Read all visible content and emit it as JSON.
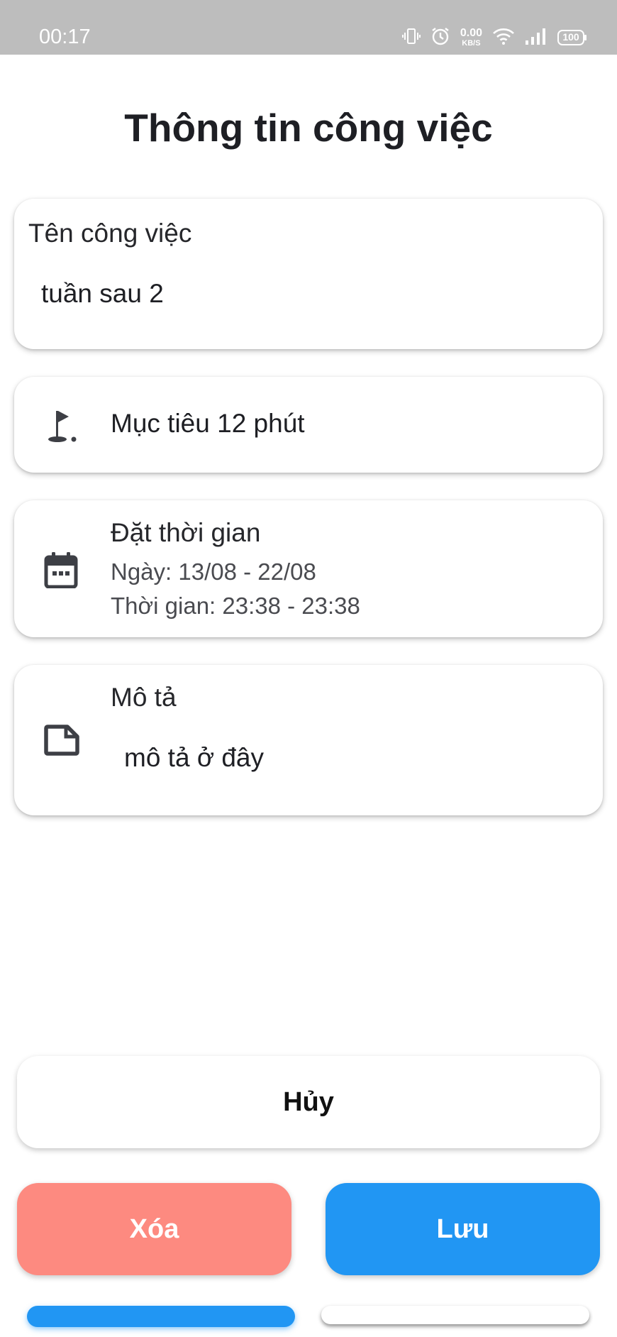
{
  "status_bar": {
    "time": "00:17",
    "speed_value": "0.00",
    "speed_unit": "KB/S",
    "battery": "100"
  },
  "page": {
    "title": "Thông tin công việc"
  },
  "task_name": {
    "label": "Tên công việc",
    "value": "tuần sau 2"
  },
  "goal": {
    "icon": "golf-flag-icon",
    "text": "Mục tiêu 12 phút"
  },
  "schedule": {
    "icon": "calendar-icon",
    "label": "Đặt thời gian",
    "date_text": "Ngày: 13/08 - 22/08",
    "time_text": "Thời gian: 23:38 - 23:38"
  },
  "description": {
    "icon": "note-icon",
    "label": "Mô tả",
    "value": "mô tả ở đây"
  },
  "buttons": {
    "cancel": "Hủy",
    "delete": "Xóa",
    "save": "Lưu"
  },
  "colors": {
    "accent": "#2196f3",
    "danger": "#fd8a80",
    "status_bar": "#bdbdbd"
  }
}
